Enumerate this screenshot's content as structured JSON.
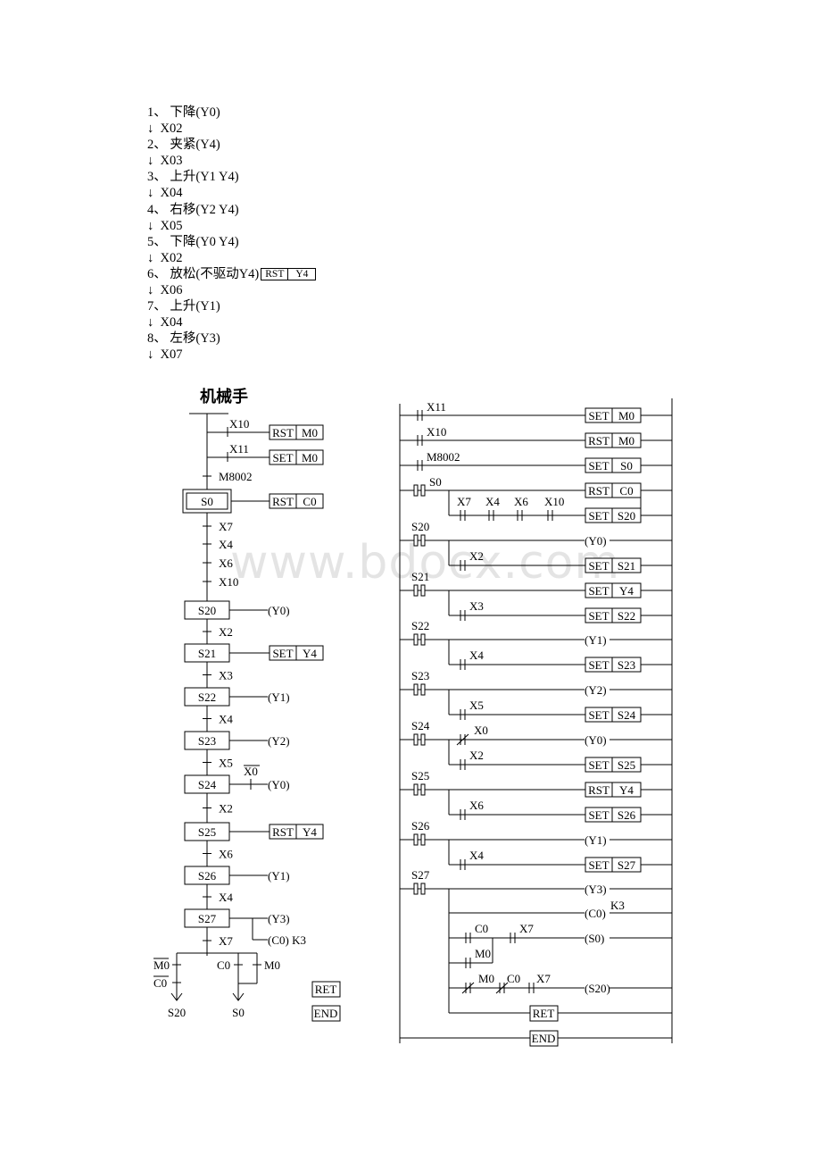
{
  "steps": [
    {
      "label": "1、 下降(Y0)"
    },
    {
      "label": "↓  X02"
    },
    {
      "label": "2、 夹紧(Y4)"
    },
    {
      "label": "↓  X03"
    },
    {
      "label": "3、 上升(Y1 Y4)"
    },
    {
      "label": "↓  X04"
    },
    {
      "label": "4、 右移(Y2 Y4)"
    },
    {
      "label": "↓  X05"
    },
    {
      "label": "5、 下降(Y0 Y4)"
    },
    {
      "label": "↓  X02"
    },
    {
      "label": "6、 放松(不驱动Y4)",
      "box": [
        "RST",
        "Y4"
      ]
    },
    {
      "label": "↓  X06"
    },
    {
      "label": "7、 上升(Y1)"
    },
    {
      "label": "↓  X04"
    },
    {
      "label": "8、 左移(Y3)"
    },
    {
      "label": "↓  X07"
    }
  ],
  "sfc": {
    "title": "机械手",
    "init": {
      "branches": [
        {
          "contact": "X10",
          "instr": [
            "RST",
            "M0"
          ]
        },
        {
          "contact": "X11",
          "instr": [
            "SET",
            "M0"
          ]
        }
      ],
      "transition": "M8002",
      "step": "S0",
      "step_action": [
        "RST",
        "C0"
      ],
      "transitions": [
        "X7",
        "X4",
        "X6",
        "X10"
      ]
    },
    "chain": [
      {
        "step": "S20",
        "action": "(Y0)",
        "transition": "X2"
      },
      {
        "step": "S21",
        "action_box": [
          "SET",
          "Y4"
        ],
        "transition": "X3"
      },
      {
        "step": "S22",
        "action": "(Y1)",
        "transition": "X4"
      },
      {
        "step": "S23",
        "action": "(Y2)",
        "transition": "X5"
      },
      {
        "step": "S24",
        "action": "(Y0)",
        "interlock": "X0",
        "transition": "X2"
      },
      {
        "step": "S25",
        "action_box": [
          "RST",
          "Y4"
        ],
        "transition": "X6"
      },
      {
        "step": "S26",
        "action": "(Y1)",
        "transition": "X4"
      },
      {
        "step": "S27",
        "action": "(Y3)",
        "action2": "(C0) K3",
        "transition": "X7"
      }
    ],
    "branch_left": {
      "contacts": [
        "M0",
        "C0"
      ],
      "target": "S20"
    },
    "branch_right": {
      "contacts": [
        "C0",
        "M0"
      ],
      "target": "S0"
    },
    "ret": "RET",
    "end": "END"
  },
  "ladder": {
    "rungs": [
      {
        "contact": "X11",
        "out": [
          "SET",
          "M0"
        ]
      },
      {
        "contact": "X10",
        "out": [
          "RST",
          "M0"
        ]
      },
      {
        "contact": "M8002",
        "out": [
          "SET",
          "S0"
        ]
      },
      {
        "stl": "S0",
        "out": [
          "RST",
          "C0"
        ],
        "series": [
          "X7",
          "X4",
          "X6",
          "X10"
        ],
        "out2": [
          "SET",
          "S20"
        ]
      },
      {
        "stl": "S20",
        "coil": "(Y0)",
        "contact": "X2",
        "out2": [
          "SET",
          "S21"
        ]
      },
      {
        "stl": "S21",
        "out": [
          "SET",
          "Y4"
        ],
        "contact": "X3",
        "out2": [
          "SET",
          "S22"
        ]
      },
      {
        "stl": "S22",
        "coil": "(Y1)",
        "contact": "X4",
        "out2": [
          "SET",
          "S23"
        ]
      },
      {
        "stl": "S23",
        "coil": "(Y2)",
        "contact": "X5",
        "out2": [
          "SET",
          "S24"
        ]
      },
      {
        "stl": "S24",
        "nc": "X0",
        "coil": "(Y0)",
        "contact": "X2",
        "out2": [
          "SET",
          "S25"
        ]
      },
      {
        "stl": "S25",
        "out": [
          "RST",
          "Y4"
        ],
        "contact": "X6",
        "out2": [
          "SET",
          "S26"
        ]
      },
      {
        "stl": "S26",
        "coil": "(Y1)",
        "contact": "X4",
        "out2": [
          "SET",
          "S27"
        ]
      },
      {
        "stl": "S27",
        "coil": "(Y3)",
        "coil2": "(C0)",
        "k": "K3",
        "r1": [
          "C0",
          "X7",
          "(S0)"
        ],
        "r1_parallel": "M0",
        "r2": [
          "M0",
          "C0",
          "X7",
          "(S20)"
        ]
      }
    ],
    "ret": "RET",
    "end": "END"
  },
  "watermark": "www.bdocx.com"
}
